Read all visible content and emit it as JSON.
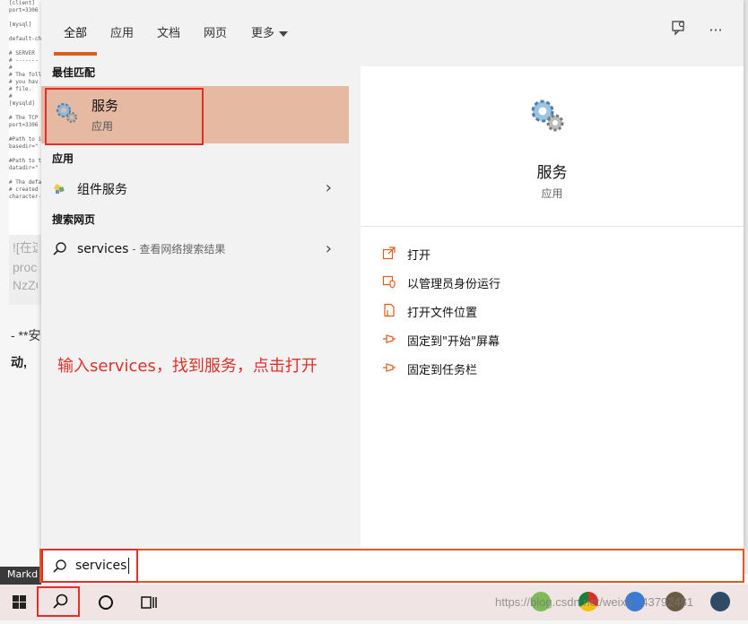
{
  "background": {
    "doc_lines": [
      "[client]",
      "port=3306",
      "",
      "[mysql]",
      "",
      "default-ch",
      "",
      "# SERVER",
      "# -------",
      "#",
      "# The foll",
      "# you hav",
      "# file.",
      "#",
      "[mysqld]",
      "",
      "# The TCP",
      "port=3306",
      "",
      "#Path to i",
      "basedir=\"",
      "",
      "#Path to t",
      "datadir=\"",
      "",
      "# The defa",
      "# created",
      "character-"
    ],
    "gray_lines": [
      "![在这",
      "proc",
      "NzZC"
    ],
    "text_line1": "- **安",
    "text_line2": "动,",
    "editor_label": "Markd"
  },
  "tabs": [
    {
      "label": "全部",
      "active": true
    },
    {
      "label": "应用"
    },
    {
      "label": "文档"
    },
    {
      "label": "网页"
    },
    {
      "label": "更多"
    }
  ],
  "top_icons": {
    "feedback": "feedback-icon",
    "more": "···"
  },
  "left": {
    "best_match_title": "最佳匹配",
    "best_match": {
      "name": "服务",
      "type": "应用"
    },
    "apps_title": "应用",
    "apps": [
      {
        "label": "组件服务"
      }
    ],
    "web_title": "搜索网页",
    "web": [
      {
        "query": "services",
        "suffix": " - 查看网络搜索结果"
      }
    ]
  },
  "annotation": "输入services，找到服务，点击打开",
  "right": {
    "title": "服务",
    "subtitle": "应用",
    "actions": [
      {
        "label": "打开",
        "icon": "open-icon"
      },
      {
        "label": "以管理员身份运行",
        "icon": "shield-icon"
      },
      {
        "label": "打开文件位置",
        "icon": "file-location-icon"
      },
      {
        "label": "固定到\"开始\"屏幕",
        "icon": "pin-icon"
      },
      {
        "label": "固定到任务栏",
        "icon": "pin-icon"
      }
    ]
  },
  "search": {
    "value": "services",
    "placeholder": ""
  },
  "taskbar": {
    "watermark": "https://blog.csdn.net/weixin_43792481"
  },
  "colors": {
    "accent": "#e05b1a",
    "highlight": "#e6b9a2",
    "annotation_red": "#e0302a"
  }
}
